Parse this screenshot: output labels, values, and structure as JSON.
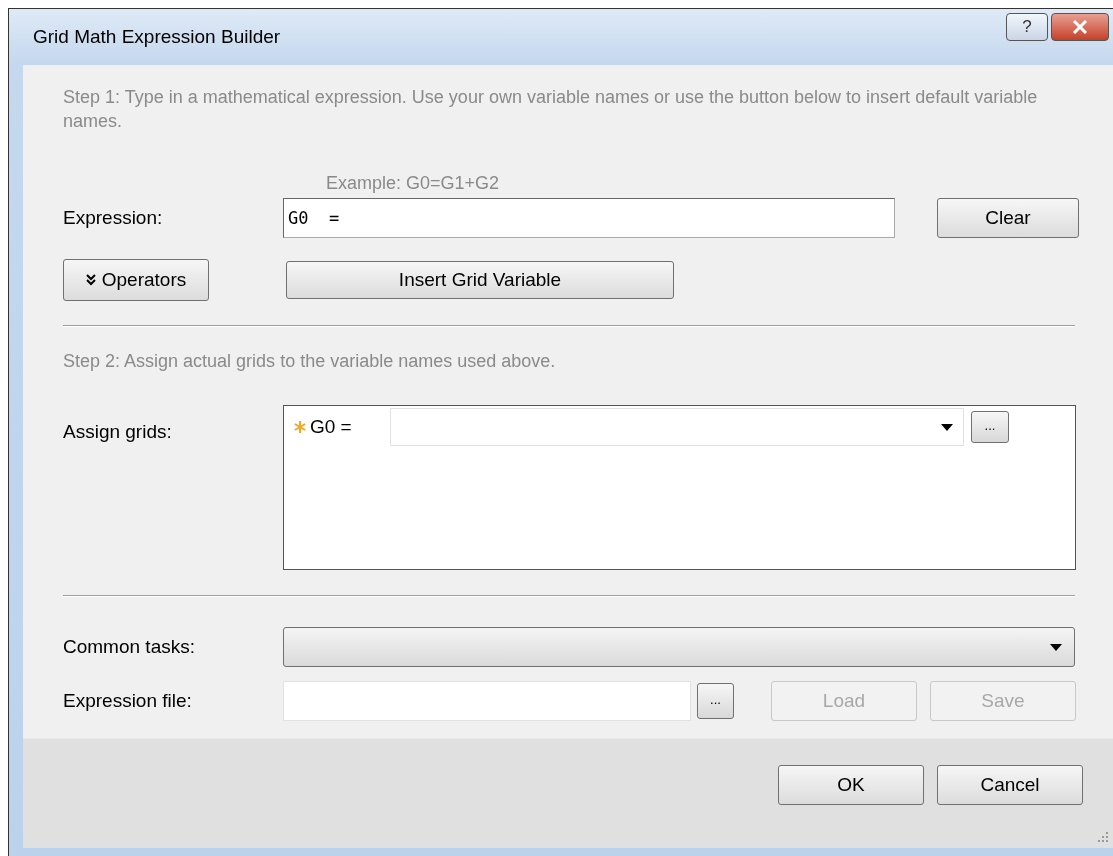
{
  "window": {
    "title": "Grid Math Expression Builder",
    "help_button": "?"
  },
  "step1": {
    "instruction": "Step 1: Type in a mathematical expression. Use your own variable names or use the button below to insert default variable names.",
    "example": "Example: G0=G1+G2",
    "expression_label": "Expression:",
    "expression_value": "G0  =",
    "clear_button": "Clear",
    "operators_button": {
      "label": "Operators",
      "expanded": false
    },
    "insert_button": "Insert Grid Variable"
  },
  "step2": {
    "instruction": "Step 2: Assign actual grids to the variable names used above.",
    "assign_label": "Assign grids:",
    "assignments": [
      {
        "variable": "G0 =",
        "required": true,
        "browse": "..."
      }
    ]
  },
  "common_tasks_label": "Common tasks:",
  "expression_file": {
    "label": "Expression file:",
    "browse": "...",
    "load": {
      "label": "Load",
      "disabled": true
    },
    "save": {
      "label": "Save",
      "disabled": true
    }
  },
  "buttons": [
    "OK",
    "Cancel"
  ]
}
